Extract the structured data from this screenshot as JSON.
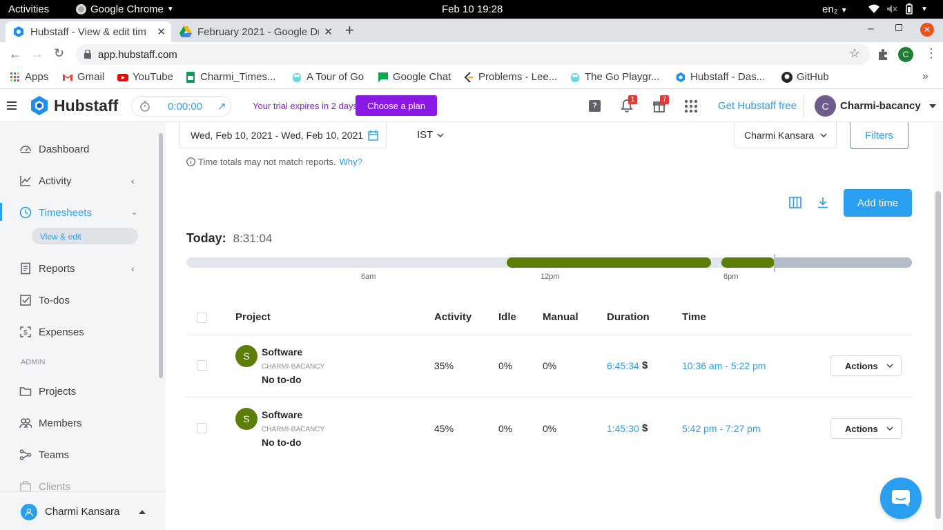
{
  "system_bar": {
    "activities": "Activities",
    "app": "Google Chrome",
    "datetime": "Feb 10  19:28",
    "lang": "en₂"
  },
  "tabs": [
    {
      "label": "Hubstaff - View & edit tim",
      "icon": "hubstaff-icon"
    },
    {
      "label": "February 2021 - Google Dr",
      "icon": "drive-icon"
    }
  ],
  "omnibox": {
    "url": "app.hubstaff.com"
  },
  "bookmarks": [
    {
      "label": "Apps",
      "icon": "apps-grid-icon"
    },
    {
      "label": "Gmail",
      "icon": "gmail-icon"
    },
    {
      "label": "YouTube",
      "icon": "youtube-icon"
    },
    {
      "label": "Charmi_Times...",
      "icon": "sheets-icon"
    },
    {
      "label": "A Tour of Go",
      "icon": "gopher-icon"
    },
    {
      "label": "Google Chat",
      "icon": "chat-icon"
    },
    {
      "label": "Problems - Lee...",
      "icon": "leetcode-icon"
    },
    {
      "label": "The Go Playgr...",
      "icon": "gopher-icon"
    },
    {
      "label": "Hubstaff - Das...",
      "icon": "hubstaff-icon"
    },
    {
      "label": "GitHub",
      "icon": "github-icon"
    }
  ],
  "header": {
    "brand": "Hubstaff",
    "timer": "0:00:00",
    "trial_text": "Your trial expires in 2 days.",
    "choose_plan": "Choose a plan",
    "notif_count": "1",
    "gift_count": "7",
    "get_free": "Get Hubstaff free",
    "user_initial": "C",
    "user_name": "Charmi-bacancy"
  },
  "sidebar": {
    "items": [
      {
        "label": "Dashboard",
        "icon": "dashboard-icon"
      },
      {
        "label": "Activity",
        "icon": "activity-chart-icon"
      },
      {
        "label": "Timesheets",
        "icon": "clock-icon"
      },
      {
        "label": "View & edit"
      },
      {
        "label": "Reports",
        "icon": "reports-icon"
      },
      {
        "label": "To-dos",
        "icon": "todo-check-icon"
      },
      {
        "label": "Expenses",
        "icon": "expenses-icon"
      },
      {
        "label": "Projects",
        "icon": "folder-icon"
      },
      {
        "label": "Members",
        "icon": "members-icon"
      },
      {
        "label": "Teams",
        "icon": "teams-icon"
      },
      {
        "label": "Clients",
        "icon": "clients-icon"
      }
    ],
    "admin_label": "ADMIN",
    "footer_user": "Charmi Kansara"
  },
  "filters": {
    "date_range": "Wed, Feb 10, 2021 - Wed, Feb 10, 2021",
    "timezone": "IST",
    "member": "Charmi Kansara",
    "filters_button": "Filters"
  },
  "notice": {
    "text": "Time totals may not match reports.",
    "link": "Why?"
  },
  "toolbar": {
    "add_time": "Add time"
  },
  "today": {
    "label": "Today:",
    "total": "8:31:04"
  },
  "timeline": {
    "ticks": [
      "6am",
      "12pm",
      "6pm"
    ],
    "segments": [
      {
        "start": "10:36 am",
        "end": "5:22 pm"
      },
      {
        "start": "5:42 pm",
        "end": "7:27 pm"
      }
    ],
    "colors": {
      "worked": "#5b7f06",
      "empty": "#e2e6ed",
      "future": "#b3bcc8"
    }
  },
  "table": {
    "headers": [
      "Project",
      "Activity",
      "Idle",
      "Manual",
      "Duration",
      "Time"
    ],
    "rows": [
      {
        "initial": "S",
        "project": "Software",
        "org": "CHARMI-BACANCY",
        "todo": "No to-do",
        "activity": "35%",
        "idle": "0%",
        "manual": "0%",
        "duration": "6:45:34",
        "currency": "$",
        "time": "10:36 am - 5:22 pm",
        "actions": "Actions"
      },
      {
        "initial": "S",
        "project": "Software",
        "org": "CHARMI-BACANCY",
        "todo": "No to-do",
        "activity": "45%",
        "idle": "0%",
        "manual": "0%",
        "duration": "1:45:30",
        "currency": "$",
        "time": "5:42 pm - 7:27 pm",
        "actions": "Actions"
      }
    ]
  },
  "colors": {
    "accent": "#2a9ff0",
    "purple": "#8a19e6",
    "project_avatar": "#5b7f06",
    "user_avatar": "#6e5c8c"
  }
}
